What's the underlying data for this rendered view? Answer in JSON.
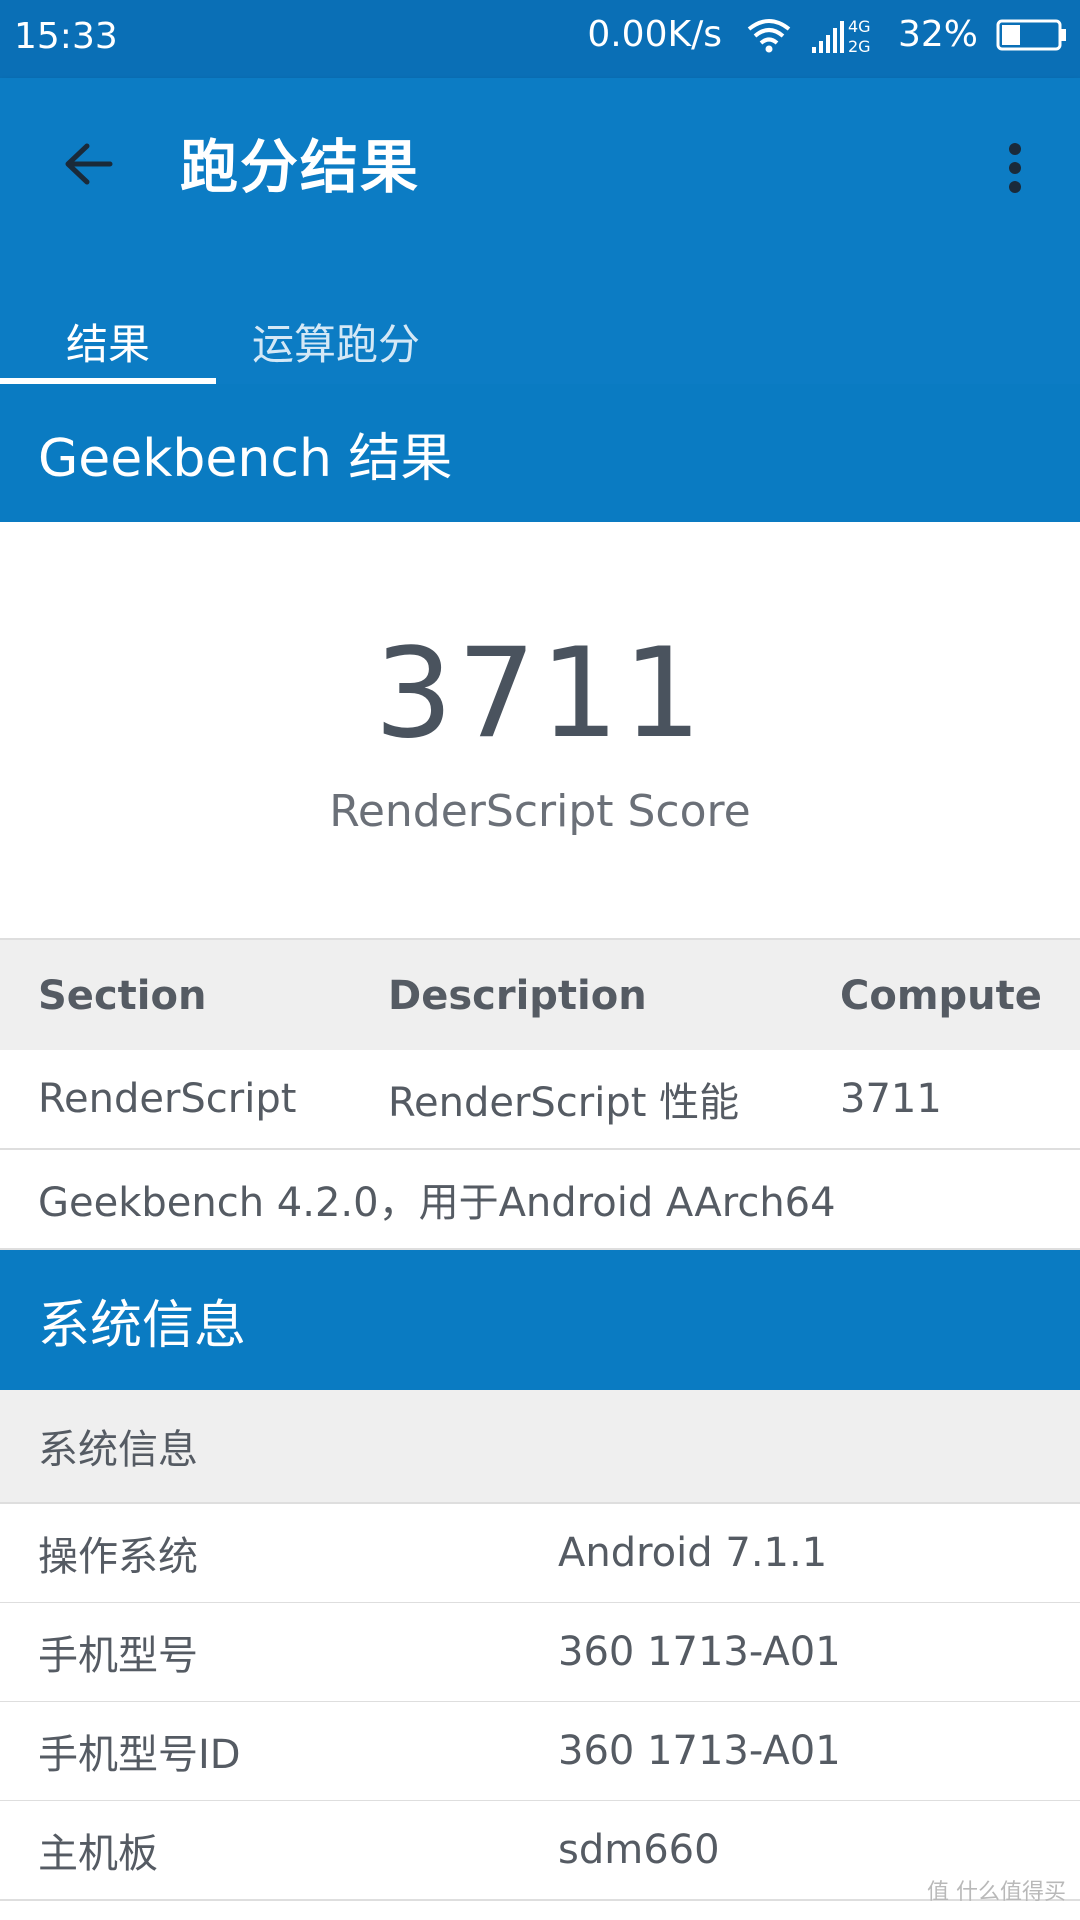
{
  "status_bar": {
    "time": "15:33",
    "net_speed": "0.00K/s",
    "network_types": [
      "4G",
      "2G"
    ],
    "battery": "32%"
  },
  "app_bar": {
    "title": "跑分结果",
    "tabs": [
      {
        "label": "结果",
        "active": true
      },
      {
        "label": "运算跑分",
        "active": false
      }
    ]
  },
  "geekbench": {
    "header": "Geekbench 结果",
    "score": "3711",
    "score_label": "RenderScript Score",
    "table": {
      "columns": [
        "Section",
        "Description",
        "Compute"
      ],
      "rows": [
        [
          "RenderScript",
          "RenderScript 性能",
          "3711"
        ]
      ],
      "version_text": "Geekbench 4.2.0，用于Android AArch64"
    }
  },
  "system_info": {
    "header": "系统信息",
    "subheader": "系统信息",
    "rows": [
      {
        "key": "操作系统",
        "value": "Android 7.1.1"
      },
      {
        "key": "手机型号",
        "value": "360 1713-A01"
      },
      {
        "key": "手机型号ID",
        "value": "360 1713-A01"
      },
      {
        "key": "主机板",
        "value": "sdm660"
      }
    ]
  },
  "watermark": "值 什么值得买",
  "colors": {
    "primary": "#0c7cc4",
    "status_bar": "#0a6fb6",
    "score_text": "#4a535e",
    "table_header_bg": "#efefef"
  }
}
